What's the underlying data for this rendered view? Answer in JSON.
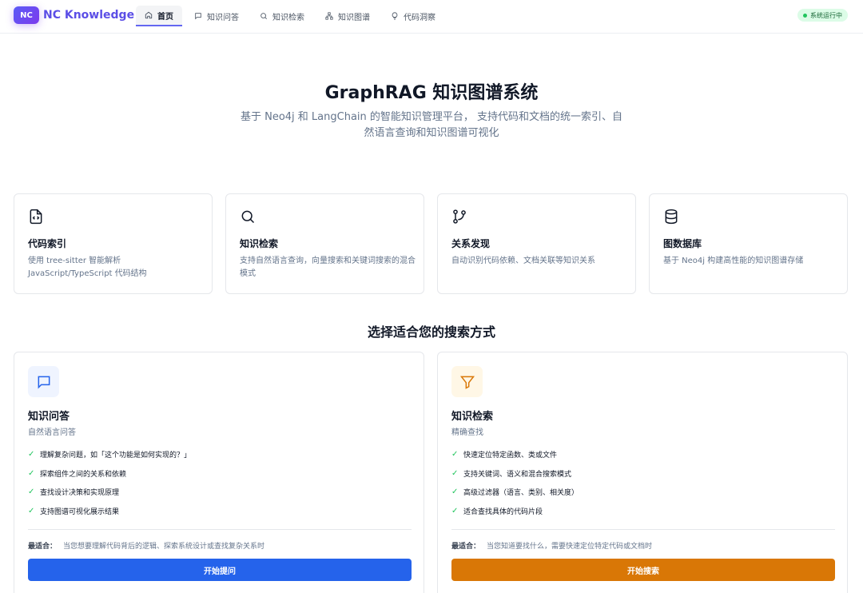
{
  "header": {
    "logo": "NC",
    "brand": "NC Knowledge",
    "nav": [
      {
        "label": "首页",
        "icon": "home-icon",
        "active": true
      },
      {
        "label": "知识问答",
        "icon": "chat-icon"
      },
      {
        "label": "知识检索",
        "icon": "search-icon"
      },
      {
        "label": "知识图谱",
        "icon": "graph-icon"
      },
      {
        "label": "代码洞察",
        "icon": "bulb-icon"
      }
    ],
    "status": "系统运行中"
  },
  "hero": {
    "title": "GraphRAG 知识图谱系统",
    "subtitle": "基于 Neo4j 和 LangChain 的智能知识管理平台， 支持代码和文档的统一索引、自然语言查询和知识图谱可视化"
  },
  "features": [
    {
      "icon": "code-file-icon",
      "title": "代码索引",
      "desc": "使用 tree-sitter 智能解析 JavaScript/TypeScript 代码结构"
    },
    {
      "icon": "search-icon",
      "title": "知识检索",
      "desc": "支持自然语言查询，向量搜索和关键词搜索的混合模式"
    },
    {
      "icon": "git-branch-icon",
      "title": "关系发现",
      "desc": "自动识别代码依赖、文档关联等知识关系"
    },
    {
      "icon": "database-icon",
      "title": "图数据库",
      "desc": "基于 Neo4j 构建高性能的知识图谱存储"
    }
  ],
  "section_title": "选择适合您的搜索方式",
  "modes": [
    {
      "icon": "chat-icon",
      "title": "知识问答",
      "subtitle": "自然语言问答",
      "items": [
        "理解复杂问题，如「这个功能是如何实现的？」",
        "探索组件之间的关系和依赖",
        "查找设计决策和实现原理",
        "支持图谱可视化展示结果"
      ],
      "best_label": "最适合：",
      "best_text": "当您想要理解代码背后的逻辑、探索系统设计或查找复杂关系时",
      "button": "开始提问",
      "accent": "#2563eb",
      "icon_bg": "#eff4ff"
    },
    {
      "icon": "filter-icon",
      "title": "知识检索",
      "subtitle": "精确查找",
      "items": [
        "快速定位特定函数、类或文件",
        "支持关键词、语义和混合搜索模式",
        "高级过滤器（语言、类别、相关度）",
        "适合查找具体的代码片段"
      ],
      "best_label": "最适合：",
      "best_text": "当您知道要找什么，需要快速定位特定代码或文档时",
      "button": "开始搜索",
      "accent": "#d97706",
      "icon_bg": "#fff7e6"
    }
  ]
}
